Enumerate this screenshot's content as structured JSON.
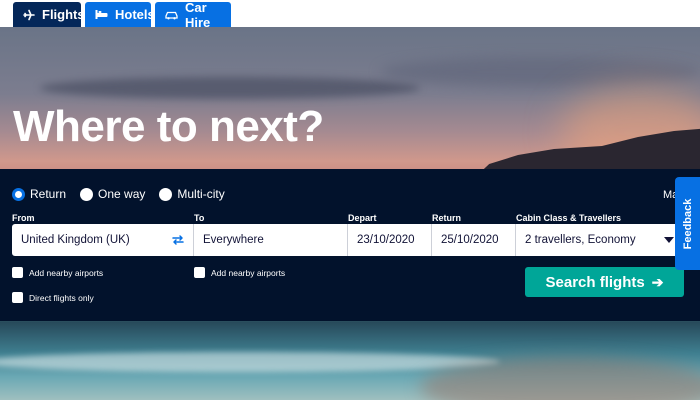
{
  "tabs": [
    {
      "label": "Flights",
      "icon": "plane-icon",
      "active": true
    },
    {
      "label": "Hotels",
      "icon": "bed-icon",
      "active": false
    },
    {
      "label": "Car Hire",
      "icon": "car-icon",
      "active": false
    }
  ],
  "hero": {
    "headline": "Where to next?"
  },
  "search": {
    "trip_types": [
      {
        "label": "Return",
        "selected": true
      },
      {
        "label": "One way",
        "selected": false
      },
      {
        "label": "Multi-city",
        "selected": false
      }
    ],
    "more_link_partial": "Ma",
    "fields": {
      "from": {
        "label": "From",
        "value": "United Kingdom (UK)"
      },
      "to": {
        "label": "To",
        "value": "Everywhere"
      },
      "depart": {
        "label": "Depart",
        "value": "23/10/2020"
      },
      "return": {
        "label": "Return",
        "value": "25/10/2020"
      },
      "cabin": {
        "label": "Cabin Class & Travellers",
        "value": "2 travellers, Economy"
      }
    },
    "options": {
      "nearby_from": "Add nearby airports",
      "nearby_to": "Add nearby airports",
      "direct_only": "Direct flights only"
    },
    "button_label": "Search flights"
  },
  "feedback_label": "Feedback",
  "colors": {
    "tab_active": "#042759",
    "tab_inactive": "#0770e3",
    "panel": "#02122c",
    "search_button": "#00a698",
    "feedback": "#0770e3"
  }
}
